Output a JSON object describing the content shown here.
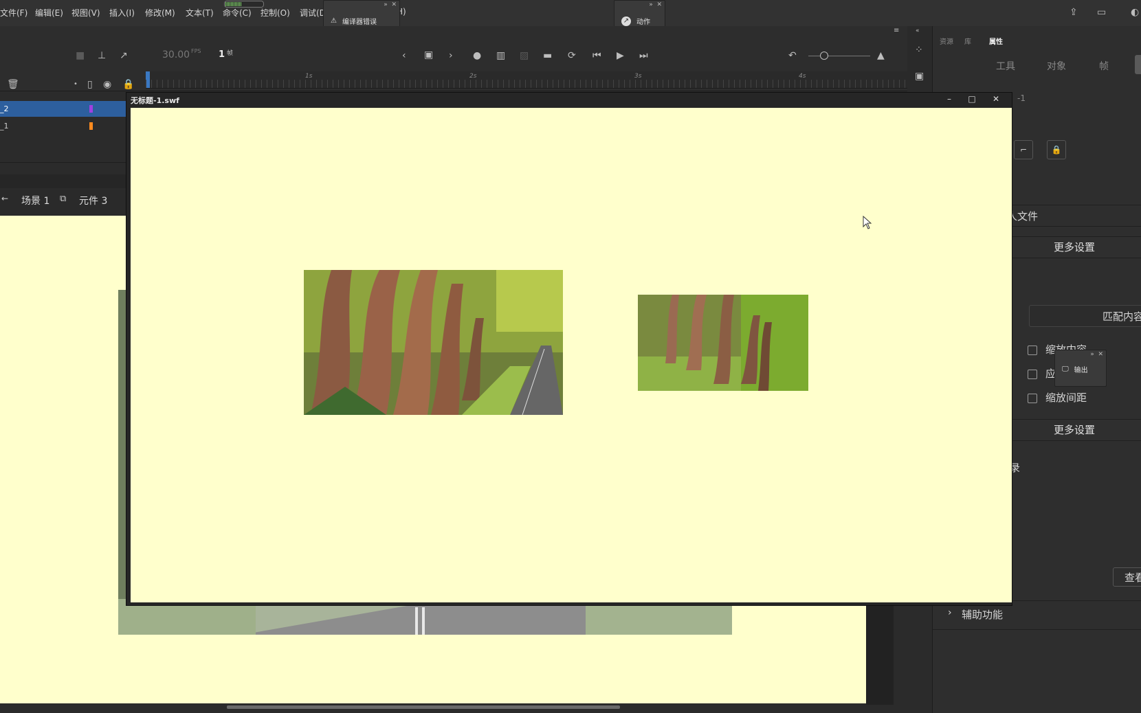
{
  "menubar": {
    "items": [
      "文件(F)",
      "编辑(E)",
      "视图(V)",
      "插入(I)",
      "修改(M)",
      "文本(T)",
      "命令(C)",
      "控制(O)",
      "调试(D",
      "H)"
    ]
  },
  "floating_panels": {
    "compiler_errors": "编译器错误",
    "actions": "动作",
    "output": "输出"
  },
  "timeline": {
    "fps": "30.00",
    "fps_unit": "FPS",
    "frame": "1",
    "frame_unit": "帧",
    "ruler_labels": [
      "1s",
      "2s",
      "3s",
      "4s"
    ]
  },
  "layers": [
    {
      "name": "_2",
      "selected": true,
      "color": "#a040e0"
    },
    {
      "name": "_1",
      "selected": false,
      "color": "#ff8a1e"
    }
  ],
  "scene_bar": {
    "scene": "场景 1",
    "symbol": "元件 3"
  },
  "swf_window": {
    "title": "无标题-1.swf"
  },
  "right_panel": {
    "top_tabs": [
      "资源",
      "库",
      "属性"
    ],
    "sub_tabs": [
      "工具",
      "对象",
      "帧"
    ],
    "doc_name_partial": "-1",
    "from_file_partial": "人文件",
    "more_settings_1": "更多设置",
    "match_contents": "匹配内容",
    "scale_content": "缩放内容",
    "apply_partial": "应",
    "scale_spacing": "缩放间距",
    "more_settings_2": "更多设置",
    "record_partial": "录",
    "view_partial": "查看",
    "accessibility": "辅助功能"
  },
  "colors": {
    "stage": "#ffffcc",
    "ui_dark": "#2b2b2b",
    "selection": "#2d5f9e"
  }
}
